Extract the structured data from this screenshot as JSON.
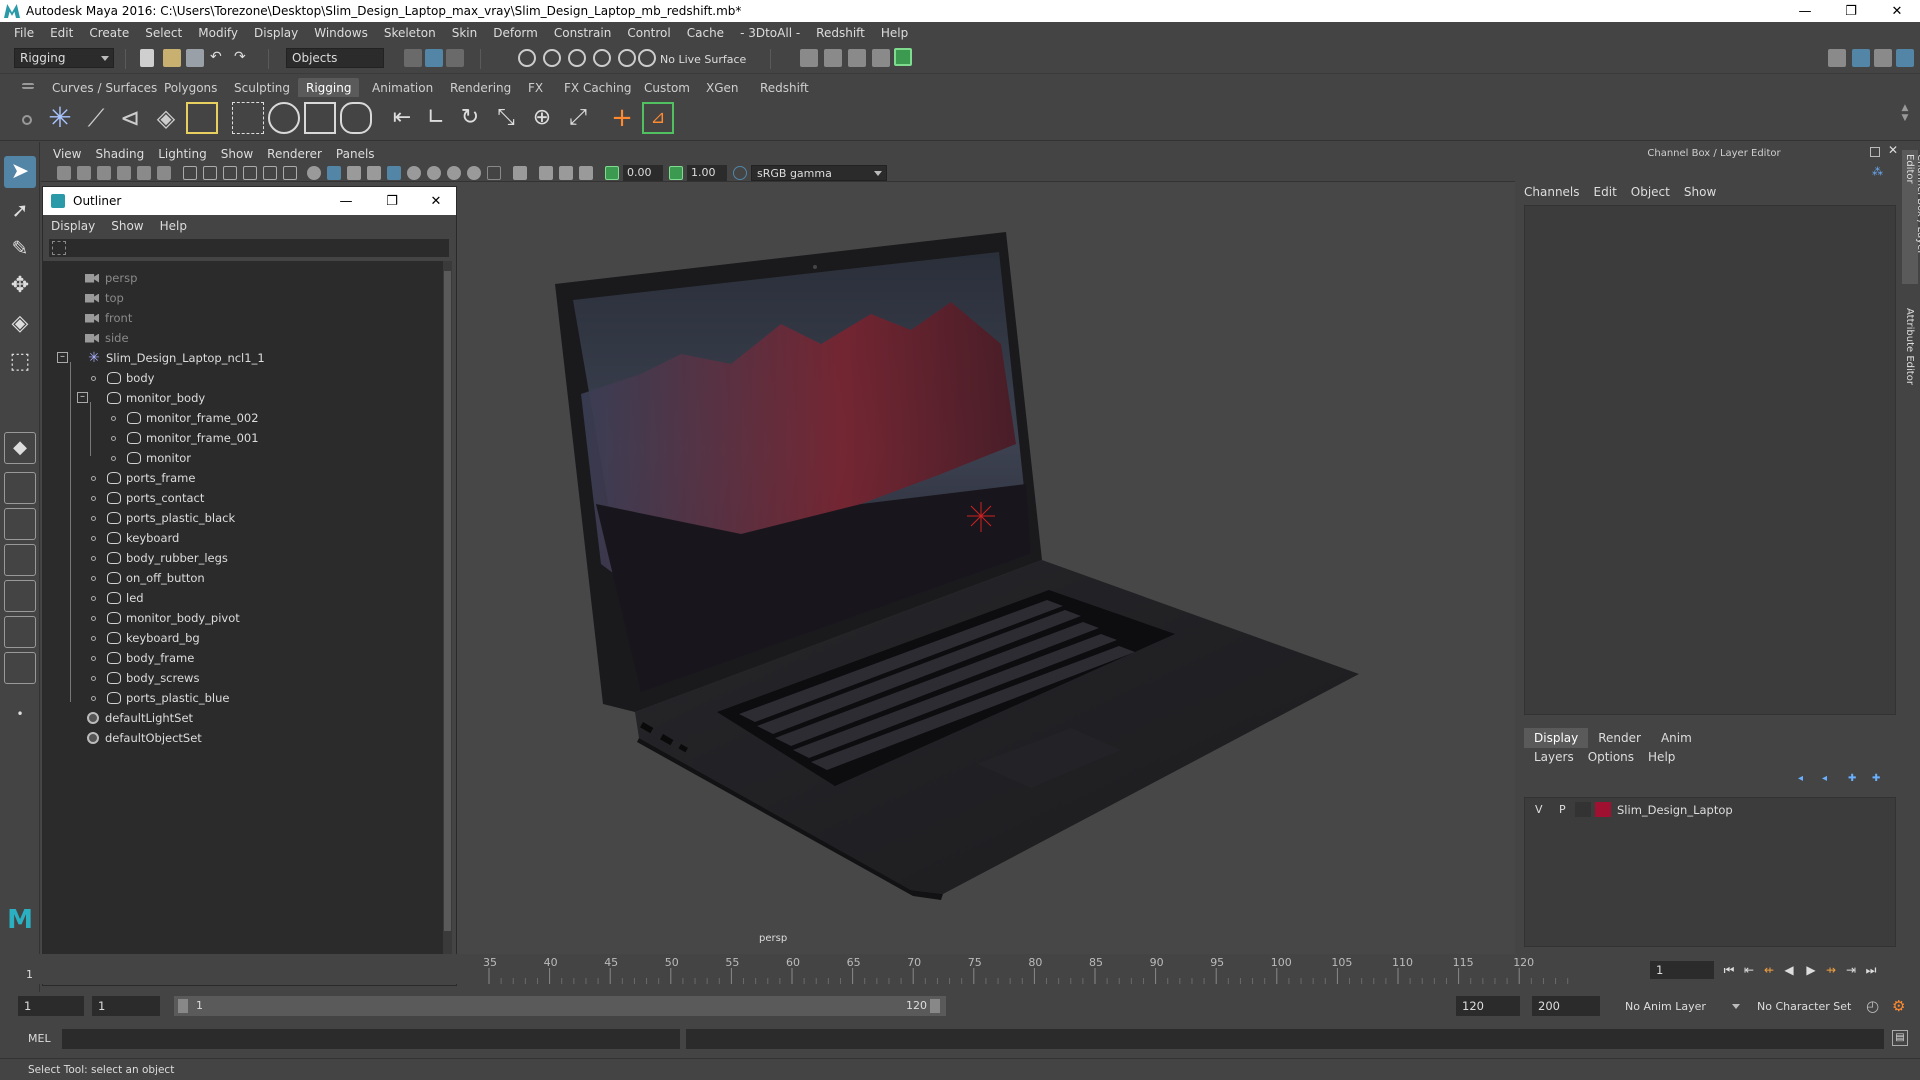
{
  "window": {
    "title": "Autodesk Maya 2016: C:\\Users\\Torezone\\Desktop\\Slim_Design_Laptop_max_vray\\Slim_Design_Laptop_mb_redshift.mb*",
    "minimize": "—",
    "maximize": "❐",
    "close": "✕"
  },
  "menubar": [
    "File",
    "Edit",
    "Create",
    "Select",
    "Modify",
    "Display",
    "Windows",
    "Skeleton",
    "Skin",
    "Deform",
    "Constrain",
    "Control",
    "Cache",
    "- 3DtoAll -",
    "Redshift",
    "Help"
  ],
  "statusline": {
    "menuset": "Rigging",
    "select_mode": "Objects",
    "live_surface": "No Live Surface"
  },
  "shelf": {
    "tabs": [
      "Curves / Surfaces",
      "Polygons",
      "Sculpting",
      "Rigging",
      "Animation",
      "Rendering",
      "FX",
      "FX Caching",
      "Custom",
      "XGen",
      "Redshift"
    ],
    "active_tab": "Rigging"
  },
  "viewport": {
    "menu": [
      "View",
      "Shading",
      "Lighting",
      "Show",
      "Renderer",
      "Panels"
    ],
    "exposure": "0.00",
    "gamma": "1.00",
    "color_space": "sRGB gamma",
    "camera_label": "persp"
  },
  "outliner": {
    "title": "Outliner",
    "menu": [
      "Display",
      "Show",
      "Help"
    ],
    "items": [
      {
        "label": "persp",
        "type": "camera",
        "depth": 0
      },
      {
        "label": "top",
        "type": "camera",
        "depth": 0
      },
      {
        "label": "front",
        "type": "camera",
        "depth": 0
      },
      {
        "label": "side",
        "type": "camera",
        "depth": 0
      },
      {
        "label": "Slim_Design_Laptop_ncl1_1",
        "type": "group",
        "depth": 0
      },
      {
        "label": "body",
        "type": "mesh",
        "depth": 1
      },
      {
        "label": "monitor_body",
        "type": "mesh",
        "depth": 1
      },
      {
        "label": "monitor_frame_002",
        "type": "mesh",
        "depth": 2
      },
      {
        "label": "monitor_frame_001",
        "type": "mesh",
        "depth": 2
      },
      {
        "label": "monitor",
        "type": "mesh",
        "depth": 2
      },
      {
        "label": "ports_frame",
        "type": "mesh",
        "depth": 1
      },
      {
        "label": "ports_contact",
        "type": "mesh",
        "depth": 1
      },
      {
        "label": "ports_plastic_black",
        "type": "mesh",
        "depth": 1
      },
      {
        "label": "keyboard",
        "type": "mesh",
        "depth": 1
      },
      {
        "label": "body_rubber_legs",
        "type": "mesh",
        "depth": 1
      },
      {
        "label": "on_off_button",
        "type": "mesh",
        "depth": 1
      },
      {
        "label": "led",
        "type": "mesh",
        "depth": 1
      },
      {
        "label": "monitor_body_pivot",
        "type": "mesh",
        "depth": 1
      },
      {
        "label": "keyboard_bg",
        "type": "mesh",
        "depth": 1
      },
      {
        "label": "body_frame",
        "type": "mesh",
        "depth": 1
      },
      {
        "label": "body_screws",
        "type": "mesh",
        "depth": 1
      },
      {
        "label": "ports_plastic_blue",
        "type": "mesh",
        "depth": 1
      },
      {
        "label": "defaultLightSet",
        "type": "set",
        "depth": 0
      },
      {
        "label": "defaultObjectSet",
        "type": "set",
        "depth": 0
      }
    ]
  },
  "channelbox": {
    "header": "Channel Box / Layer Editor",
    "menu": [
      "Channels",
      "Edit",
      "Object",
      "Show"
    ],
    "layer_tabs": [
      "Display",
      "Render",
      "Anim"
    ],
    "active_layer_tab": "Display",
    "layer_menu": [
      "Layers",
      "Options",
      "Help"
    ],
    "layer": {
      "v": "V",
      "p": "P",
      "name": "Slim_Design_Laptop",
      "color": "#a01030"
    },
    "side_tabs": [
      "Channel Box / Layer Editor",
      "Attribute Editor"
    ]
  },
  "timeline": {
    "ticks": [
      "35",
      "40",
      "45",
      "50",
      "55",
      "60",
      "65",
      "70",
      "75",
      "80",
      "85",
      "90",
      "95",
      "100",
      "105",
      "110",
      "115",
      "120"
    ],
    "current_frame": "1",
    "frame_marker": "1"
  },
  "range": {
    "start": "1",
    "playback_start": "1",
    "slider_start": "1",
    "slider_end": "120",
    "playback_end": "120",
    "end": "200",
    "anim_layer": "No Anim Layer",
    "character_set": "No Character Set"
  },
  "cmdline": {
    "label": "MEL"
  },
  "helpline": {
    "text": "Select Tool: select an object"
  },
  "colors": {
    "accent": "#2a9aa8",
    "panel": "#444444",
    "field": "#2b2b2b",
    "layer_red": "#a01030",
    "highlight": "#5285a6"
  }
}
